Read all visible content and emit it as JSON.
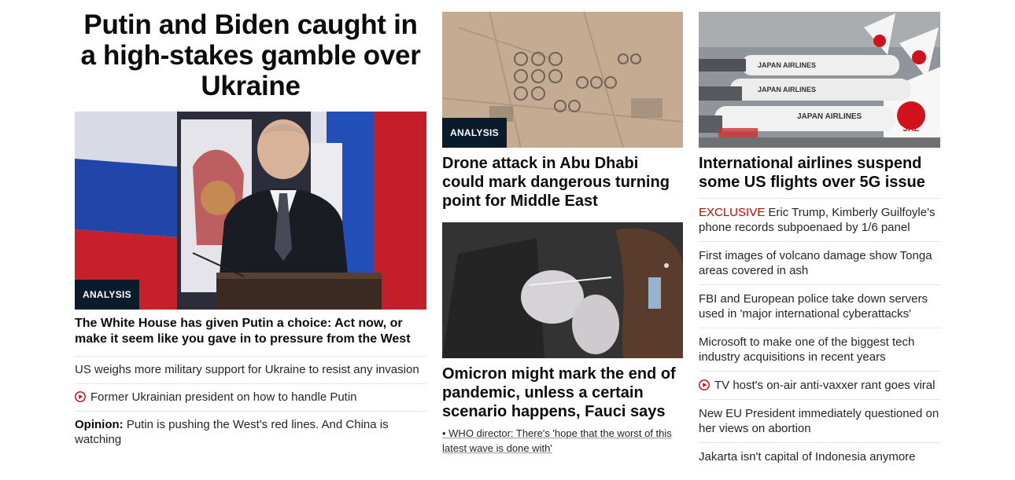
{
  "left": {
    "headline": "Putin and Biden caught in a high-stakes gamble over Ukraine",
    "badge": "ANALYSIS",
    "subheadline": "The White House has given Putin a choice: Act now, or make it seem like you gave in to pressure from the West",
    "links": [
      {
        "text": "US weighs more military support for Ukraine to resist any invasion"
      },
      {
        "text": "Former Ukrainian president on how to handle Putin",
        "icon": "play-icon"
      },
      {
        "prefix": "Opinion:",
        "text": "Putin is pushing the West's red lines. And China is watching"
      }
    ]
  },
  "middle": {
    "card1": {
      "badge": "ANALYSIS",
      "title": "Drone attack in Abu Dhabi could mark dangerous turning point for Middle East"
    },
    "card2": {
      "title": "Omicron might mark the end of pandemic, unless a certain scenario happens, Fauci says",
      "related": "• WHO director: There's 'hope that the worst of this latest wave is done with'"
    }
  },
  "right": {
    "title": "International airlines suspend some US flights over 5G issue",
    "links": [
      {
        "label": "EXCLUSIVE",
        "text": " Eric Trump, Kimberly Guilfoyle's phone records subpoenaed by 1/6 panel"
      },
      {
        "text": "First images of volcano damage show Tonga areas covered in ash"
      },
      {
        "text": "FBI and European police take down servers used in 'major international cyberattacks'"
      },
      {
        "text": "Microsoft to make one of the biggest tech industry acquisitions in recent years"
      },
      {
        "text": "TV host's on-air anti-vaxxer rant goes viral",
        "icon": "play-icon"
      },
      {
        "text": "New EU President immediately questioned on her views on abortion"
      },
      {
        "text": "Jakarta isn't capital of Indonesia anymore"
      }
    ],
    "image_text": {
      "airline1": "JAPAN AIRLINES",
      "airline2": "JAPAN AIRLINES",
      "airline3": "JAPAN AIRLINES",
      "jal": "JAL"
    }
  },
  "colors": {
    "accent": "#cc0000",
    "badge_bg": "#0a1c2c",
    "divider": "#e6e6e6"
  }
}
